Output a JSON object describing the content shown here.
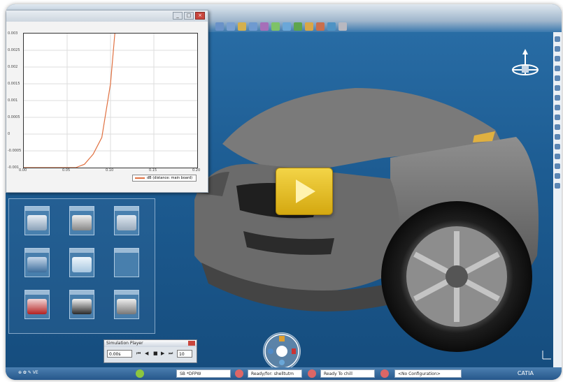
{
  "graph": {
    "y_ticks": [
      "0.003",
      "0.0025",
      "0.002",
      "0.0015",
      "0.001",
      "0.0005",
      "0",
      "-0.0005",
      "-0.001"
    ],
    "x_ticks": [
      "0.00",
      "0.05",
      "0.10",
      "0.15",
      "0.20"
    ],
    "legend": "dB (distance: main board)"
  },
  "chart_data": {
    "type": "line",
    "series": [
      {
        "name": "dB (distance: main board)",
        "x": [
          0,
          0.04,
          0.06,
          0.07,
          0.08,
          0.09,
          0.1,
          0.105
        ],
        "y": [
          -0.001,
          -0.001,
          -0.001,
          -0.0009,
          -0.0006,
          -0.0001,
          0.0015,
          0.003
        ]
      }
    ],
    "xlim": [
      0,
      0.2
    ],
    "ylim": [
      -0.001,
      0.003
    ]
  },
  "simulation_player": {
    "title": "Simulation Player",
    "time_value": "0.00s",
    "step_value": "10",
    "controls": [
      "⏮",
      "◀",
      "■",
      "▶",
      "⏭"
    ]
  },
  "statusbar": {
    "left_tray": "⊕ ✿ ✎ VE",
    "field1": "SB *DFPW",
    "field2": "Ready/for: shelltutm",
    "field3": "Ready To chill",
    "field4": "<No Configuration>",
    "brand": "CATIA"
  }
}
